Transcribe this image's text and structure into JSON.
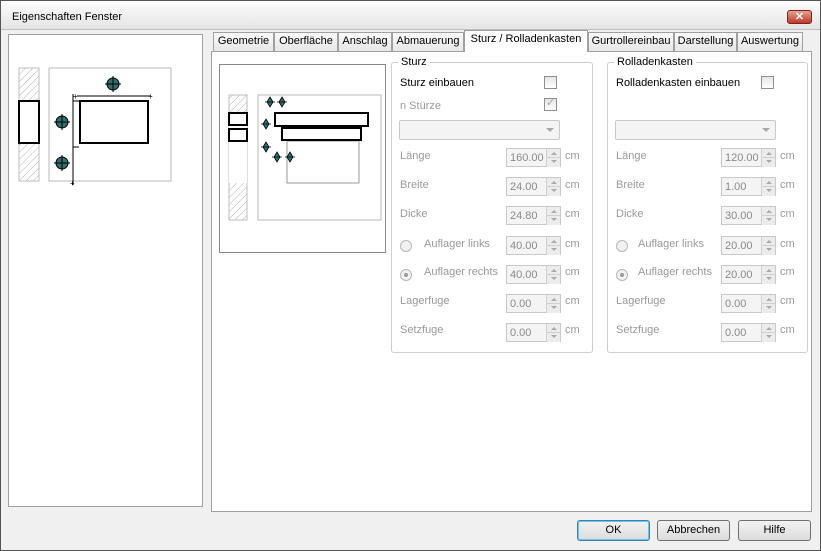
{
  "window": {
    "title": "Eigenschaften Fenster",
    "close_glyph": "✕"
  },
  "tabs": [
    "Geometrie",
    "Oberfläche",
    "Anschlag",
    "Abmauerung",
    "Sturz / Rolladenkasten",
    "Gurtrollereinbau",
    "Darstellung",
    "Auswertung"
  ],
  "active_tab": "Sturz / Rolladenkasten",
  "sturz": {
    "group_title": "Sturz",
    "einbauen_label": "Sturz einbauen",
    "einbauen_checked": false,
    "n_sturze_label": "n Stürze",
    "n_sturze_checked": true,
    "combo_value": "",
    "laenge": {
      "label": "Länge",
      "value": "160.00",
      "unit": "cm"
    },
    "breite": {
      "label": "Breite",
      "value": "24.00",
      "unit": "cm"
    },
    "dicke": {
      "label": "Dicke",
      "value": "24.80",
      "unit": "cm"
    },
    "auflager_links": {
      "label": "Auflager links",
      "value": "40.00",
      "unit": "cm",
      "selected": false
    },
    "auflager_rechts": {
      "label": "Auflager rechts",
      "value": "40.00",
      "unit": "cm",
      "selected": true
    },
    "lagerfuge": {
      "label": "Lagerfuge",
      "value": "0.00",
      "unit": "cm"
    },
    "setzfuge": {
      "label": "Setzfuge",
      "value": "0.00",
      "unit": "cm"
    }
  },
  "rolladenkasten": {
    "group_title": "Rolladenkasten",
    "einbauen_label": "Rolladenkasten einbauen",
    "einbauen_checked": false,
    "combo_value": "",
    "laenge": {
      "label": "Länge",
      "value": "120.00",
      "unit": "cm"
    },
    "breite": {
      "label": "Breite",
      "value": "1.00",
      "unit": "cm"
    },
    "dicke": {
      "label": "Dicke",
      "value": "30.00",
      "unit": "cm"
    },
    "auflager_links": {
      "label": "Auflager links",
      "value": "20.00",
      "unit": "cm",
      "selected": false
    },
    "auflager_rechts": {
      "label": "Auflager rechts",
      "value": "20.00",
      "unit": "cm",
      "selected": true
    },
    "lagerfuge": {
      "label": "Lagerfuge",
      "value": "0.00",
      "unit": "cm"
    },
    "setzfuge": {
      "label": "Setzfuge",
      "value": "0.00",
      "unit": "cm"
    }
  },
  "buttons": {
    "ok": "OK",
    "cancel": "Abbrechen",
    "help": "Hilfe"
  },
  "colors": {
    "marker": "#2f6f6f",
    "hatch": "#b5b5b5",
    "accent_border": "#3c7fb1"
  }
}
